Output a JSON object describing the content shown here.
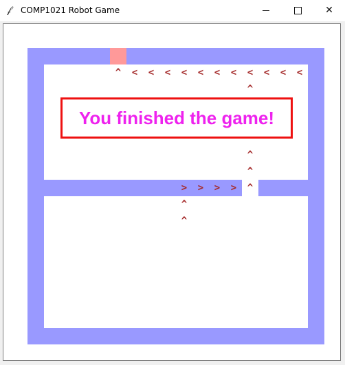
{
  "window": {
    "title": "COMP1021 Robot Game",
    "icon": "feather-icon",
    "minimize_icon": "minimize-icon",
    "maximize_icon": "maximize-icon",
    "close_label": "✕"
  },
  "game": {
    "message": "You finished the game!",
    "colors": {
      "wall": "#9999ff",
      "start": "#ff9999",
      "arrow": "#a52a2a",
      "message_text": "#ee22ee",
      "message_border": "#ee1111"
    },
    "path": [
      {
        "col": 5,
        "row": 1,
        "dir": "^"
      },
      {
        "col": 6,
        "row": 1,
        "dir": "<"
      },
      {
        "col": 7,
        "row": 1,
        "dir": "<"
      },
      {
        "col": 8,
        "row": 1,
        "dir": "<"
      },
      {
        "col": 9,
        "row": 1,
        "dir": "<"
      },
      {
        "col": 10,
        "row": 1,
        "dir": "<"
      },
      {
        "col": 11,
        "row": 1,
        "dir": "<"
      },
      {
        "col": 12,
        "row": 1,
        "dir": "<"
      },
      {
        "col": 13,
        "row": 1,
        "dir": "<"
      },
      {
        "col": 14,
        "row": 1,
        "dir": "<"
      },
      {
        "col": 15,
        "row": 1,
        "dir": "<"
      },
      {
        "col": 16,
        "row": 1,
        "dir": "<"
      },
      {
        "col": 13,
        "row": 2,
        "dir": "^"
      },
      {
        "col": 13,
        "row": 3,
        "dir": "^"
      },
      {
        "col": 13,
        "row": 4,
        "dir": "^"
      },
      {
        "col": 13,
        "row": 5,
        "dir": "^"
      },
      {
        "col": 13,
        "row": 6,
        "dir": "^"
      },
      {
        "col": 13,
        "row": 7,
        "dir": "^"
      },
      {
        "col": 13,
        "row": 8,
        "dir": "^"
      },
      {
        "col": 9,
        "row": 8,
        "dir": ">"
      },
      {
        "col": 10,
        "row": 8,
        "dir": ">"
      },
      {
        "col": 11,
        "row": 8,
        "dir": ">"
      },
      {
        "col": 12,
        "row": 8,
        "dir": ">"
      },
      {
        "col": 9,
        "row": 9,
        "dir": "^"
      },
      {
        "col": 9,
        "row": 10,
        "dir": "^"
      }
    ]
  }
}
